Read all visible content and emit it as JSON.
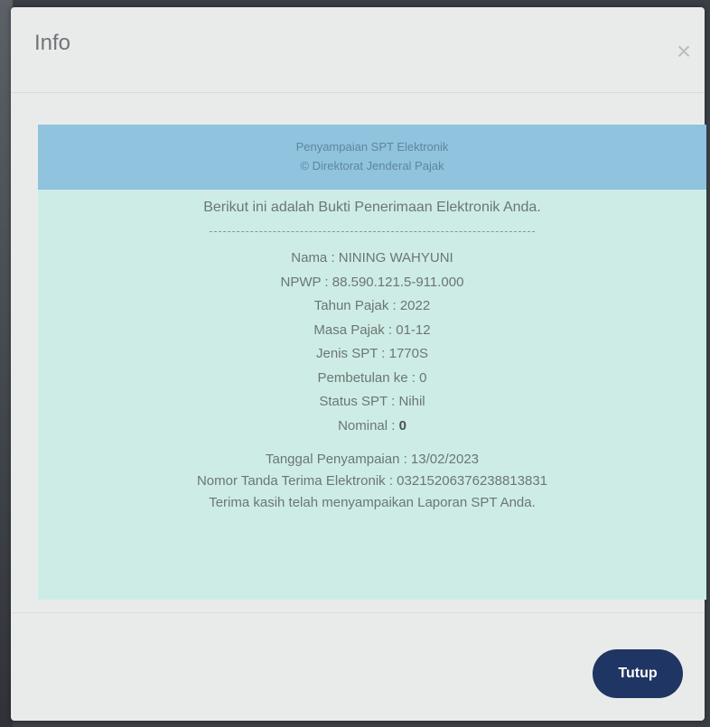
{
  "modal": {
    "title": "Info",
    "close_glyph": "×"
  },
  "receipt": {
    "header_line1": "Penyampaian SPT Elektronik",
    "header_line2": "© Direktorat Jenderal Pajak",
    "intro": "Berikut ini adalah Bukti Penerimaan Elektronik Anda.",
    "fields": {
      "nama": "Nama : NINING WAHYUNI",
      "npwp": "NPWP : 88.590.121.5-911.000",
      "tahun_pajak": "Tahun Pajak : 2022",
      "masa_pajak": "Masa Pajak : 01-12",
      "jenis_spt": "Jenis SPT : 1770S",
      "pembetulan": "Pembetulan ke : 0",
      "status_spt": "Status SPT : Nihil",
      "nominal_label": "Nominal : ",
      "nominal_value": "0"
    },
    "tanggal": "Tanggal Penyampaian : 13/02/2023",
    "nomor_tanda_terima": "Nomor Tanda Terima Elektronik : 03215206376238813831",
    "thanks": "Terima kasih telah menyampaikan Laporan SPT Anda."
  },
  "footer": {
    "close_button_label": "Tutup",
    "button_color": "#1f3563"
  },
  "icons": {
    "close": "close-icon"
  }
}
